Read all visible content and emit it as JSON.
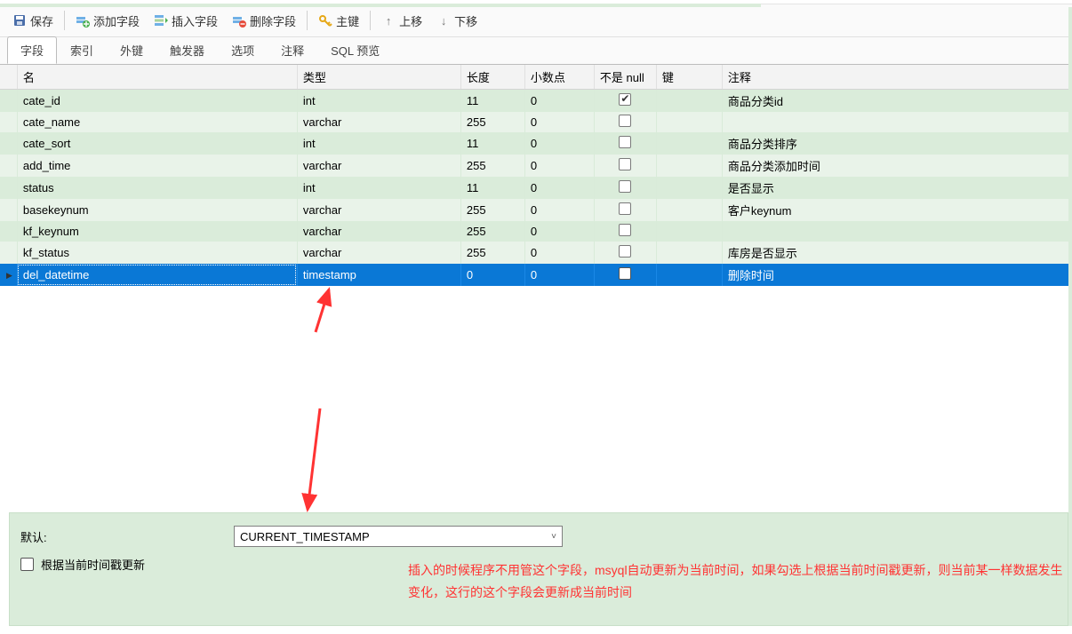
{
  "toolbar": {
    "save": "保存",
    "add_field": "添加字段",
    "insert_field": "插入字段",
    "delete_field": "删除字段",
    "primary_key": "主键",
    "move_up": "上移",
    "move_down": "下移"
  },
  "tabs": {
    "fields": "字段",
    "indexes": "索引",
    "foreign_keys": "外键",
    "triggers": "触发器",
    "options": "选项",
    "comment": "注释",
    "sql_preview": "SQL 预览"
  },
  "columns": {
    "name": "名",
    "type": "类型",
    "length": "长度",
    "decimals": "小数点",
    "not_null": "不是 null",
    "key": "键",
    "comment": "注释"
  },
  "rows": [
    {
      "name": "cate_id",
      "type": "int",
      "length": "11",
      "decimals": "0",
      "not_null": true,
      "key": "",
      "comment": "商品分类id"
    },
    {
      "name": "cate_name",
      "type": "varchar",
      "length": "255",
      "decimals": "0",
      "not_null": false,
      "key": "",
      "comment": ""
    },
    {
      "name": "cate_sort",
      "type": "int",
      "length": "11",
      "decimals": "0",
      "not_null": false,
      "key": "",
      "comment": "商品分类排序"
    },
    {
      "name": "add_time",
      "type": "varchar",
      "length": "255",
      "decimals": "0",
      "not_null": false,
      "key": "",
      "comment": "商品分类添加时间"
    },
    {
      "name": "status",
      "type": "int",
      "length": "11",
      "decimals": "0",
      "not_null": false,
      "key": "",
      "comment": "是否显示"
    },
    {
      "name": "basekeynum",
      "type": "varchar",
      "length": "255",
      "decimals": "0",
      "not_null": false,
      "key": "",
      "comment": "客户keynum"
    },
    {
      "name": "kf_keynum",
      "type": "varchar",
      "length": "255",
      "decimals": "0",
      "not_null": false,
      "key": "",
      "comment": ""
    },
    {
      "name": "kf_status",
      "type": "varchar",
      "length": "255",
      "decimals": "0",
      "not_null": false,
      "key": "",
      "comment": "库房是否显示"
    },
    {
      "name": "del_datetime",
      "type": "timestamp",
      "length": "0",
      "decimals": "0",
      "not_null": false,
      "key": "",
      "comment": "删除时间"
    }
  ],
  "selected_index": 8,
  "panel": {
    "default_label": "默认:",
    "default_value": "CURRENT_TIMESTAMP",
    "update_on_ts": "根据当前时间戳更新"
  },
  "annotation": "插入的时候程序不用管这个字段，msyql自动更新为当前时间，如果勾选上根据当前时间戳更新，则当前某一样数据发生变化，这行的这个字段会更新成当前时间"
}
